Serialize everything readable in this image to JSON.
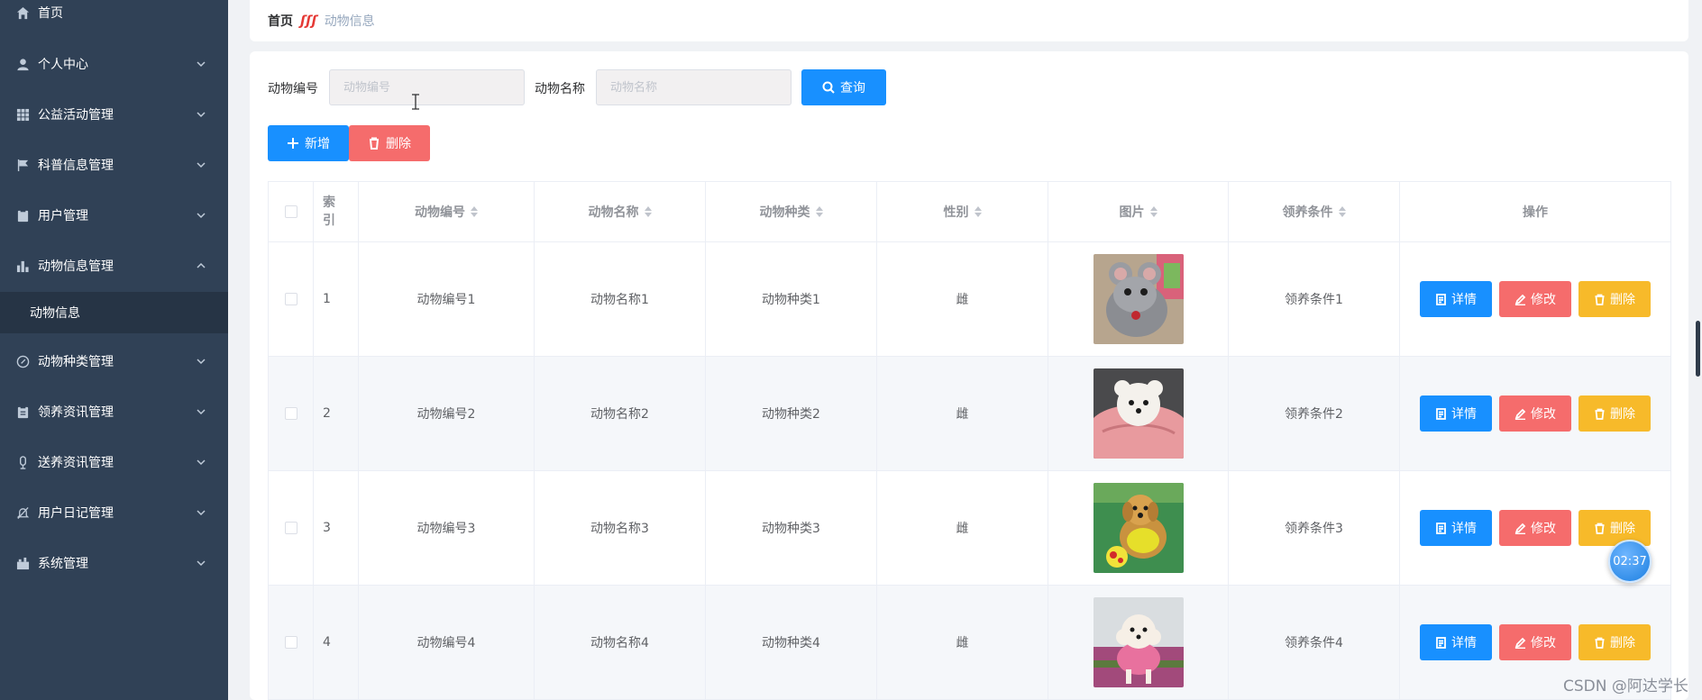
{
  "sidebar": {
    "items": [
      {
        "label": "首页",
        "icon": "home-icon"
      },
      {
        "label": "个人中心",
        "icon": "user-icon"
      },
      {
        "label": "公益活动管理",
        "icon": "grid-icon"
      },
      {
        "label": "科普信息管理",
        "icon": "flag-icon"
      },
      {
        "label": "用户管理",
        "icon": "clipboard-icon"
      },
      {
        "label": "动物信息管理",
        "icon": "bar-chart-icon"
      },
      {
        "label": "动物种类管理",
        "icon": "compass-icon"
      },
      {
        "label": "领养资讯管理",
        "icon": "clipboard-icon"
      },
      {
        "label": "送养资讯管理",
        "icon": "microphone-icon"
      },
      {
        "label": "用户日记管理",
        "icon": "bell-off-icon"
      },
      {
        "label": "系统管理",
        "icon": "briefcase-icon"
      }
    ],
    "active_sub": "动物信息"
  },
  "breadcrumb": {
    "home": "首页",
    "separator": "ʃʃʃ",
    "current": "动物信息"
  },
  "search": {
    "no_label": "动物编号",
    "no_placeholder": "动物编号",
    "name_label": "动物名称",
    "name_placeholder": "动物名称",
    "query_label": "查询"
  },
  "toolbar": {
    "add_label": "新增",
    "delete_label": "删除"
  },
  "table": {
    "headers": {
      "index": "索引",
      "no": "动物编号",
      "name": "动物名称",
      "type": "动物种类",
      "sex": "性别",
      "image": "图片",
      "condition": "领养条件",
      "actions": "操作"
    },
    "actions": {
      "detail": "详情",
      "edit": "修改",
      "delete": "删除"
    },
    "rows": [
      {
        "index": "1",
        "no": "动物编号1",
        "name": "动物名称1",
        "type": "动物种类1",
        "sex": "雌",
        "condition": "领养条件1"
      },
      {
        "index": "2",
        "no": "动物编号2",
        "name": "动物名称2",
        "type": "动物种类2",
        "sex": "雌",
        "condition": "领养条件2"
      },
      {
        "index": "3",
        "no": "动物编号3",
        "name": "动物名称3",
        "type": "动物种类3",
        "sex": "雌",
        "condition": "领养条件3"
      },
      {
        "index": "4",
        "no": "动物编号4",
        "name": "动物名称4",
        "type": "动物种类4",
        "sex": "雌",
        "condition": "领养条件4"
      }
    ]
  },
  "overlay": {
    "timer": "02:37",
    "watermark": "CSDN @阿达学长"
  },
  "colors": {
    "sidebar_bg": "#304156",
    "primary": "#1890ff",
    "danger": "#f56c6c",
    "warning": "#f7ba2a"
  }
}
